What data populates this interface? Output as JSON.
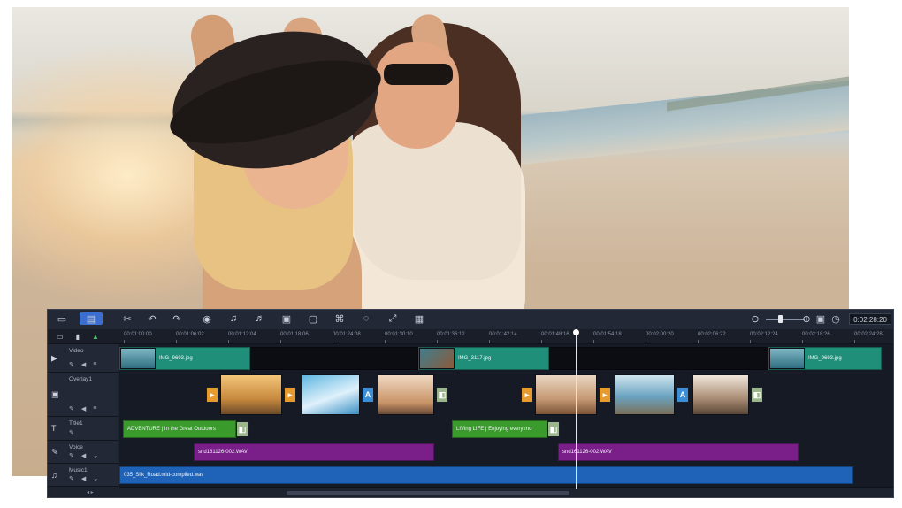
{
  "toolbar": {
    "icons": [
      "storyboard-view-icon",
      "timeline-view-icon",
      "tools-icon",
      "undo-icon",
      "redo-icon",
      "record-capture-icon",
      "sound-mixer-icon",
      "auto-music-icon",
      "motion-tracking-icon",
      "subtitle-editor-icon",
      "multi-camera-icon",
      "mask-creator-icon",
      "split-icon",
      "fit-to-window-icon",
      "render-icon"
    ],
    "zoom": "",
    "timecode": "0:02:28:20"
  },
  "ruler": {
    "ticks": [
      "00:01:00:00",
      "00:01:06:02",
      "00:01:12:04",
      "00:01:18:06",
      "00:01:24:08",
      "00:01:30:10",
      "00:01:36:12",
      "00:01:42:14",
      "00:01:48:16",
      "00:01:54:18",
      "00:02:00:20",
      "00:02:06:22",
      "00:02:12:24",
      "00:02:18:26",
      "00:02:24:28"
    ]
  },
  "tracks": {
    "video": {
      "name": "Video",
      "clips": [
        "IMG_9693.jpg",
        "IMG_3117.jpg",
        "IMG_9693.jpg"
      ]
    },
    "overlay": {
      "name": "Overlay1"
    },
    "title": {
      "name": "Title1",
      "clips": [
        "ADVENTURE | In the Great Outdoors",
        "LIVing LIFE | Enjoying every mo"
      ]
    },
    "voice": {
      "name": "Voice",
      "clips": [
        "snd161126-002.WAV",
        "snd161126-002.WAV"
      ]
    },
    "music": {
      "name": "Music1",
      "clips": [
        "035_Silk_Road.mid-compiled.wav"
      ]
    }
  },
  "colors": {
    "video_clip": "#1f8f7a",
    "title_clip": "#3a9a2c",
    "voice_clip": "#7a1f8a",
    "music_clip": "#1e63b8",
    "transition_orange": "#e79a2e",
    "transition_blue": "#3b8fd8"
  }
}
